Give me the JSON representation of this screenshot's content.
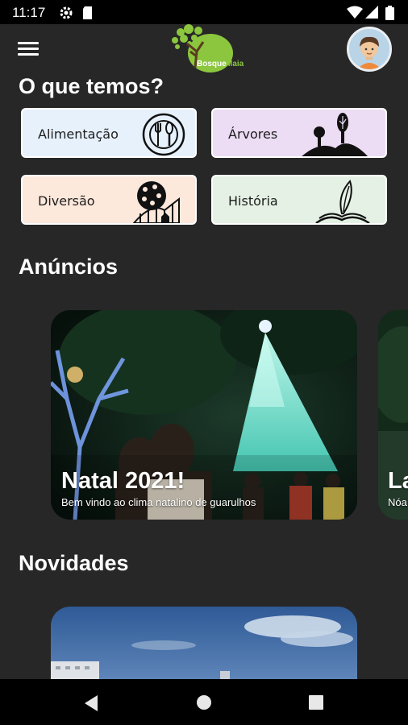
{
  "status_bar": {
    "time": "11:17"
  },
  "header": {
    "logo_text": "Bosque Maia"
  },
  "categories_section": {
    "title": "O que temos?",
    "items": [
      {
        "label": "Alimentação",
        "bg": "#e6f1fb",
        "icon": "plate-cutlery-icon"
      },
      {
        "label": "Árvores",
        "bg": "#ecdcf4",
        "icon": "trees-hill-icon"
      },
      {
        "label": "Diversão",
        "bg": "#fde8dc",
        "icon": "ferris-wheel-icon"
      },
      {
        "label": "História",
        "bg": "#e4f1e4",
        "icon": "quill-book-icon"
      }
    ]
  },
  "announcements_section": {
    "title": "Anúncios",
    "cards": [
      {
        "title": "Natal 2021!",
        "subtitle": "Bem vindo ao clima natalino de guarulhos"
      },
      {
        "title": "La",
        "subtitle": "Nóa"
      }
    ]
  },
  "news_section": {
    "title": "Novidades"
  },
  "colors": {
    "background": "#272727",
    "accent_green": "#8cc63f"
  }
}
